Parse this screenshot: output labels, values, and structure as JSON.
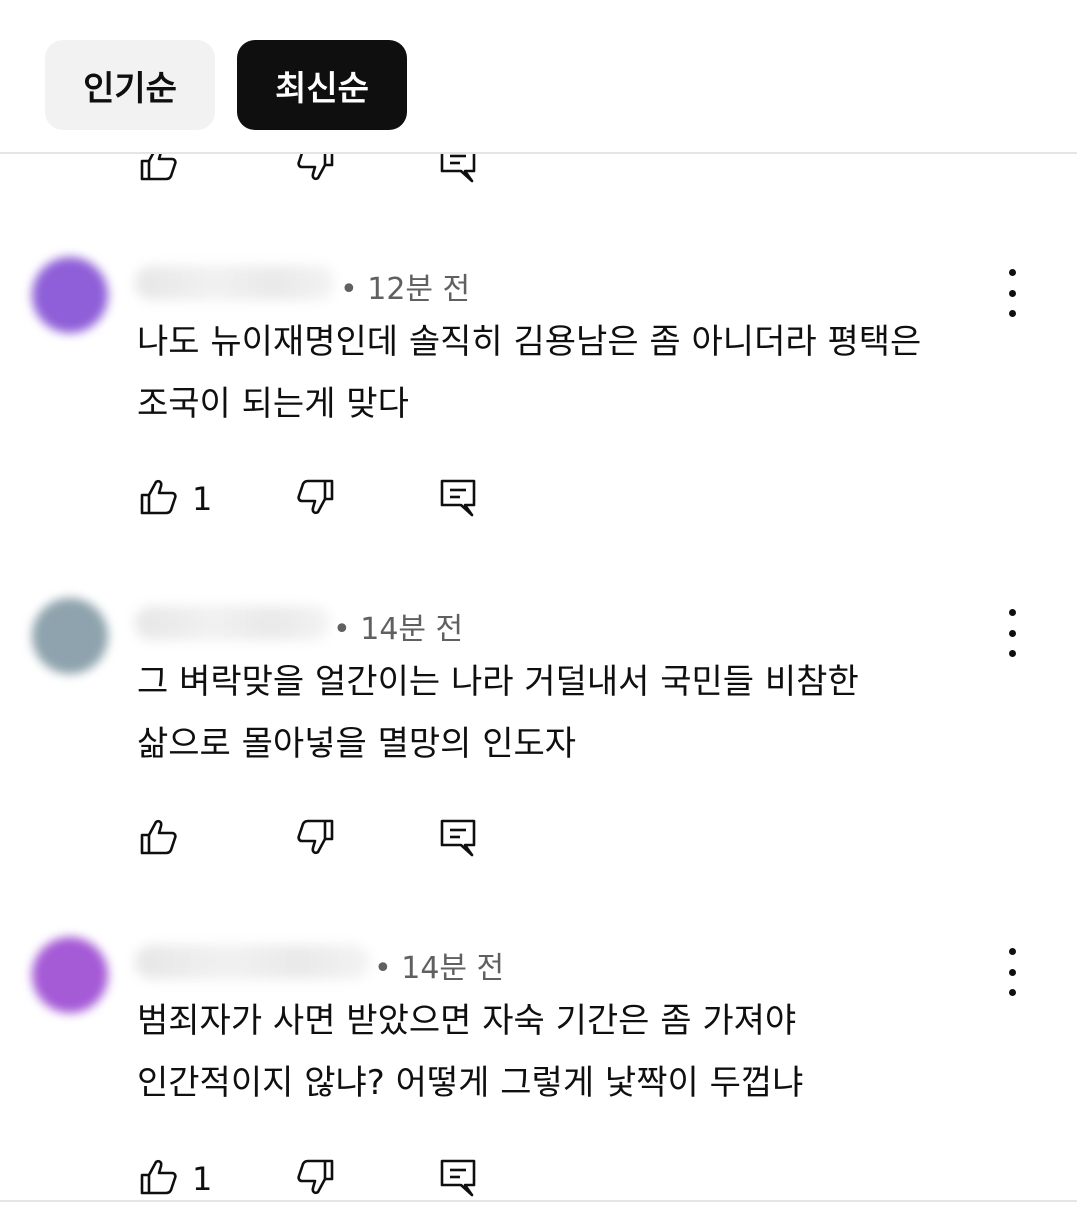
{
  "sort": {
    "popular_label": "인기순",
    "newest_label": "최신순",
    "selected": "최신순"
  },
  "comments": [
    {
      "time": "• 12분 전",
      "text_lines": [
        "나도 뉴이재명인데 솔직히 김용남은 좀 아니더라 평택은",
        "조국이 되는게 맞다"
      ],
      "likes": "1",
      "avatar_color": "#8e5fd8"
    },
    {
      "time": "• 14분 전",
      "text_lines": [
        "그 벼락맞을 얼간이는 나라 거덜내서 국민들 비참한",
        "삶으로 몰아넣을 멸망의 인도자"
      ],
      "likes": "",
      "avatar_color": "#8ea3ad"
    },
    {
      "time": "• 14분 전",
      "text_lines": [
        "범죄자가 사면 받았으면 자숙  기간은 좀 가져야",
        "인간적이지 않냐? 어떻게 그렇게 낯짝이 두껍냐"
      ],
      "likes": "1",
      "avatar_color": "#a55ad6"
    }
  ],
  "icons": {
    "like": "thumbs-up-icon",
    "dislike": "thumbs-down-icon",
    "reply": "comment-reply-icon",
    "more": "more-vertical-icon"
  },
  "colors": {
    "text": "#0f0f0f",
    "meta": "#606060",
    "chip_selected_bg": "#0f0f0f",
    "chip_bg": "#f2f2f2",
    "divider": "#e5e5e5"
  }
}
